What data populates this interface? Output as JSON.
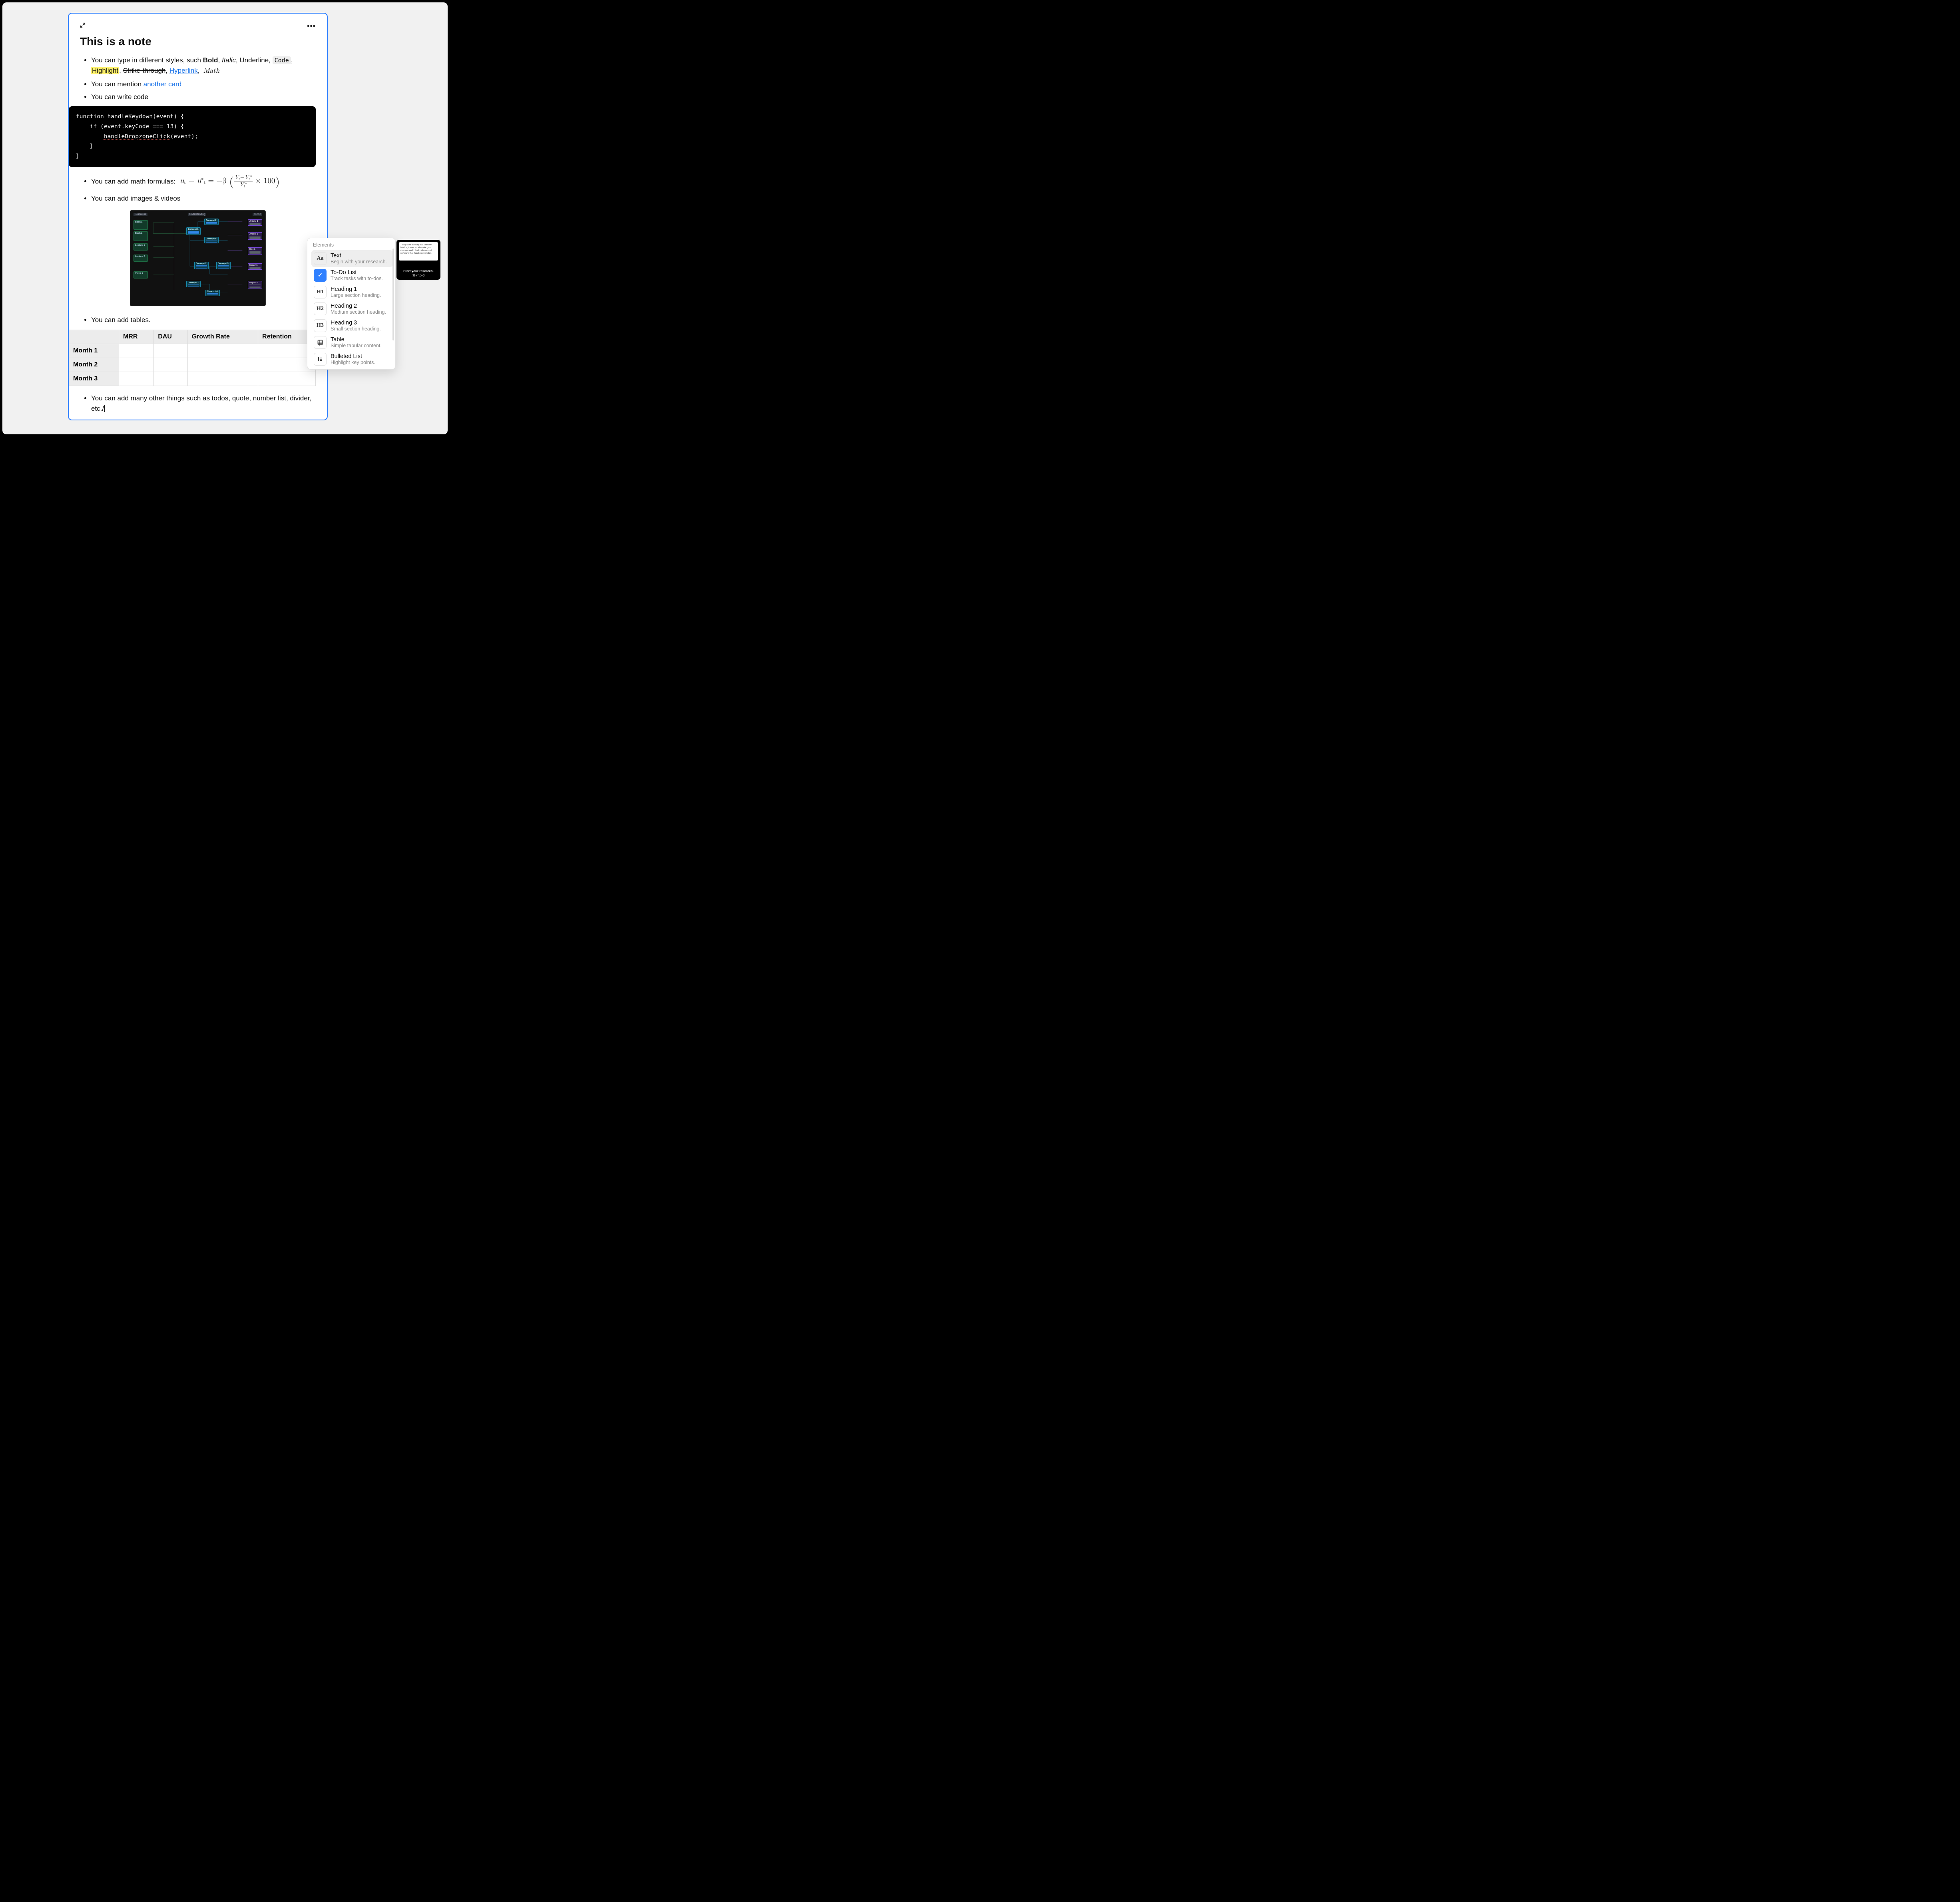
{
  "note": {
    "title": "This is a note",
    "bullets": {
      "styles_prefix": "You can type in different styles, such ",
      "bold": "Bold",
      "italic": "Italic",
      "underline": "Underline",
      "code": "Code",
      "highlight": "Highlight",
      "strike": "Strike-through",
      "hyperlink": "Hyperlink",
      "math": "Math",
      "mention_prefix": "You can mention ",
      "mention_link": "another card",
      "write_code": "You can write code",
      "math_prefix": "You can add math formulas:  ",
      "images": "You can add images & videos",
      "tables": "You can add tables.",
      "others": "You can add many other things such as todos, quote, number list, divider, etc./"
    },
    "code": {
      "l1": "function handleKeydown(event) {",
      "l2": "    if (event.keyCode === 13) {",
      "l3_a": "        ",
      "l3_call": "handleDropzoneClick",
      "l3_b": "(event);",
      "l4": "    }",
      "l5": "}"
    },
    "formula": {
      "lhs_u": "u",
      "sub_t": "t",
      "minus": " − ",
      "star": "∗",
      "eq": " = −β ",
      "Y": "Y",
      "times100": " × 100"
    },
    "embedded_image": {
      "columns": {
        "resources": "Resources",
        "understanding": "Understanding",
        "output": "Output"
      },
      "resources": [
        "Book 1",
        "Book 2",
        "Lecture 1",
        "Lecture 2",
        "Video 1"
      ],
      "concepts": [
        "Concept 1",
        "Concept 2",
        "Concept 6",
        "Concept 7",
        "Concept 5",
        "Concept 3",
        "Concept 4"
      ],
      "outputs": [
        "Article 1",
        "Article 2",
        "Doc 1",
        "Essay 1",
        "Report 1"
      ]
    },
    "table": {
      "headers": [
        "",
        "MRR",
        "DAU",
        "Growth Rate",
        "Retention"
      ],
      "rows": [
        "Month 1",
        "Month 2",
        "Month 3"
      ]
    }
  },
  "popup": {
    "header": "Elements",
    "items": [
      {
        "icon": "Aa",
        "title": "Text",
        "desc": "Begin with your research."
      },
      {
        "icon": "todo",
        "title": "To-Do List",
        "desc": "Track tasks with to-dos."
      },
      {
        "icon": "H1",
        "title": "Heading 1",
        "desc": "Large section heading."
      },
      {
        "icon": "H2",
        "title": "Heading 2",
        "desc": "Medium section heading."
      },
      {
        "icon": "H3",
        "title": "Heading 3",
        "desc": "Small section heading."
      },
      {
        "icon": "table",
        "title": "Table",
        "desc": "Simple tabular content."
      },
      {
        "icon": "bullet",
        "title": "Bulleted List",
        "desc": "Highlight key points."
      }
    ]
  },
  "preview": {
    "body": "Today was the day that I discov Modus, it was an absolute gam changer and I finally discovered software that handles everythin",
    "line1": "Start your research.",
    "line2": "⌘+⌥+0"
  }
}
